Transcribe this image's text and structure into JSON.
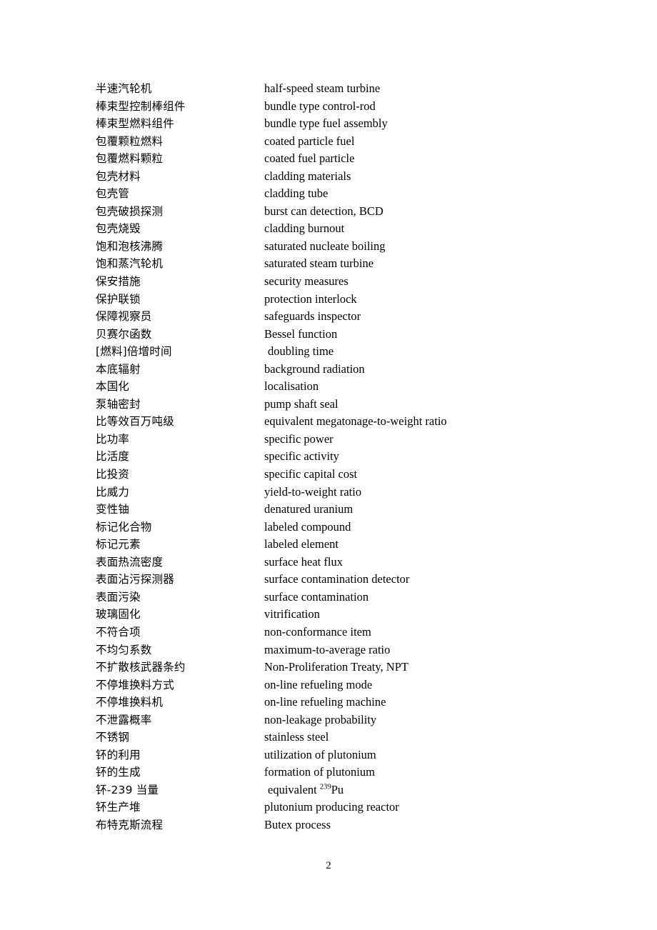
{
  "document": {
    "page_number": "2",
    "entries": [
      {
        "zh": "半速汽轮机",
        "en": "half-speed steam turbine"
      },
      {
        "zh": "棒束型控制棒组件",
        "en": "bundle type control-rod"
      },
      {
        "zh": "棒束型燃料组件",
        "en": "bundle type fuel assembly"
      },
      {
        "zh": "包覆颗粒燃料",
        "en": "coated particle fuel"
      },
      {
        "zh": "包覆燃料颗粒",
        "en": "coated fuel particle"
      },
      {
        "zh": "包壳材料",
        "en": "cladding materials"
      },
      {
        "zh": "包壳管",
        "en": "cladding tube"
      },
      {
        "zh": "包壳破损探测",
        "en": "burst can detection, BCD"
      },
      {
        "zh": "包壳烧毁",
        "en": "cladding burnout"
      },
      {
        "zh": "饱和泡核沸腾",
        "en": "saturated nucleate boiling"
      },
      {
        "zh": "饱和蒸汽轮机",
        "en": "saturated steam turbine"
      },
      {
        "zh": "保安措施",
        "en": "security measures"
      },
      {
        "zh": "保护联锁",
        "en": "protection interlock"
      },
      {
        "zh": "保障视察员",
        "en": "safeguards inspector"
      },
      {
        "zh": "贝赛尔函数",
        "en": "Bessel function"
      },
      {
        "zh": "[燃料]倍增时间",
        "en": "doubling time",
        "indent": true
      },
      {
        "zh": "本底辐射",
        "en": "background radiation"
      },
      {
        "zh": "本国化",
        "en": "localisation"
      },
      {
        "zh": "泵轴密封",
        "en": "pump shaft seal"
      },
      {
        "zh": "比等效百万吨级",
        "en": "equivalent megatonage-to-weight ratio"
      },
      {
        "zh": "比功率",
        "en": "specific power"
      },
      {
        "zh": "比活度",
        "en": "specific activity"
      },
      {
        "zh": "比投资",
        "en": "specific capital cost"
      },
      {
        "zh": "比威力",
        "en": "yield-to-weight ratio"
      },
      {
        "zh": "变性铀",
        "en": "denatured uranium"
      },
      {
        "zh": "标记化合物",
        "en": "labeled compound"
      },
      {
        "zh": "标记元素",
        "en": "labeled element"
      },
      {
        "zh": "表面热流密度",
        "en": "surface heat flux"
      },
      {
        "zh": "表面沾污探测器",
        "en": "surface contamination detector"
      },
      {
        "zh": "表面污染",
        "en": "surface contamination"
      },
      {
        "zh": "玻璃固化",
        "en": "vitrification"
      },
      {
        "zh": "不符合项",
        "en": "non-conformance item"
      },
      {
        "zh": "不均匀系数",
        "en": "maximum-to-average ratio"
      },
      {
        "zh": "不扩散核武器条约",
        "en": "Non-Proliferation Treaty, NPT"
      },
      {
        "zh": "不停堆换料方式",
        "en": "on-line refueling mode"
      },
      {
        "zh": "不停堆换料机",
        "en": "on-line refueling machine"
      },
      {
        "zh": "不泄露概率",
        "en": "non-leakage probability"
      },
      {
        "zh": "不锈钢",
        "en": "stainless steel"
      },
      {
        "zh": "钚的利用",
        "en": "utilization of plutonium"
      },
      {
        "zh": "钚的生成",
        "en": "formation of plutonium"
      },
      {
        "zh": "钚-239 当量",
        "en_html": "equivalent <sup>239</sup>Pu",
        "indent": true
      },
      {
        "zh": "钚生产堆",
        "en": "plutonium producing reactor"
      },
      {
        "zh": "布特克斯流程",
        "en": "Butex process"
      }
    ]
  }
}
